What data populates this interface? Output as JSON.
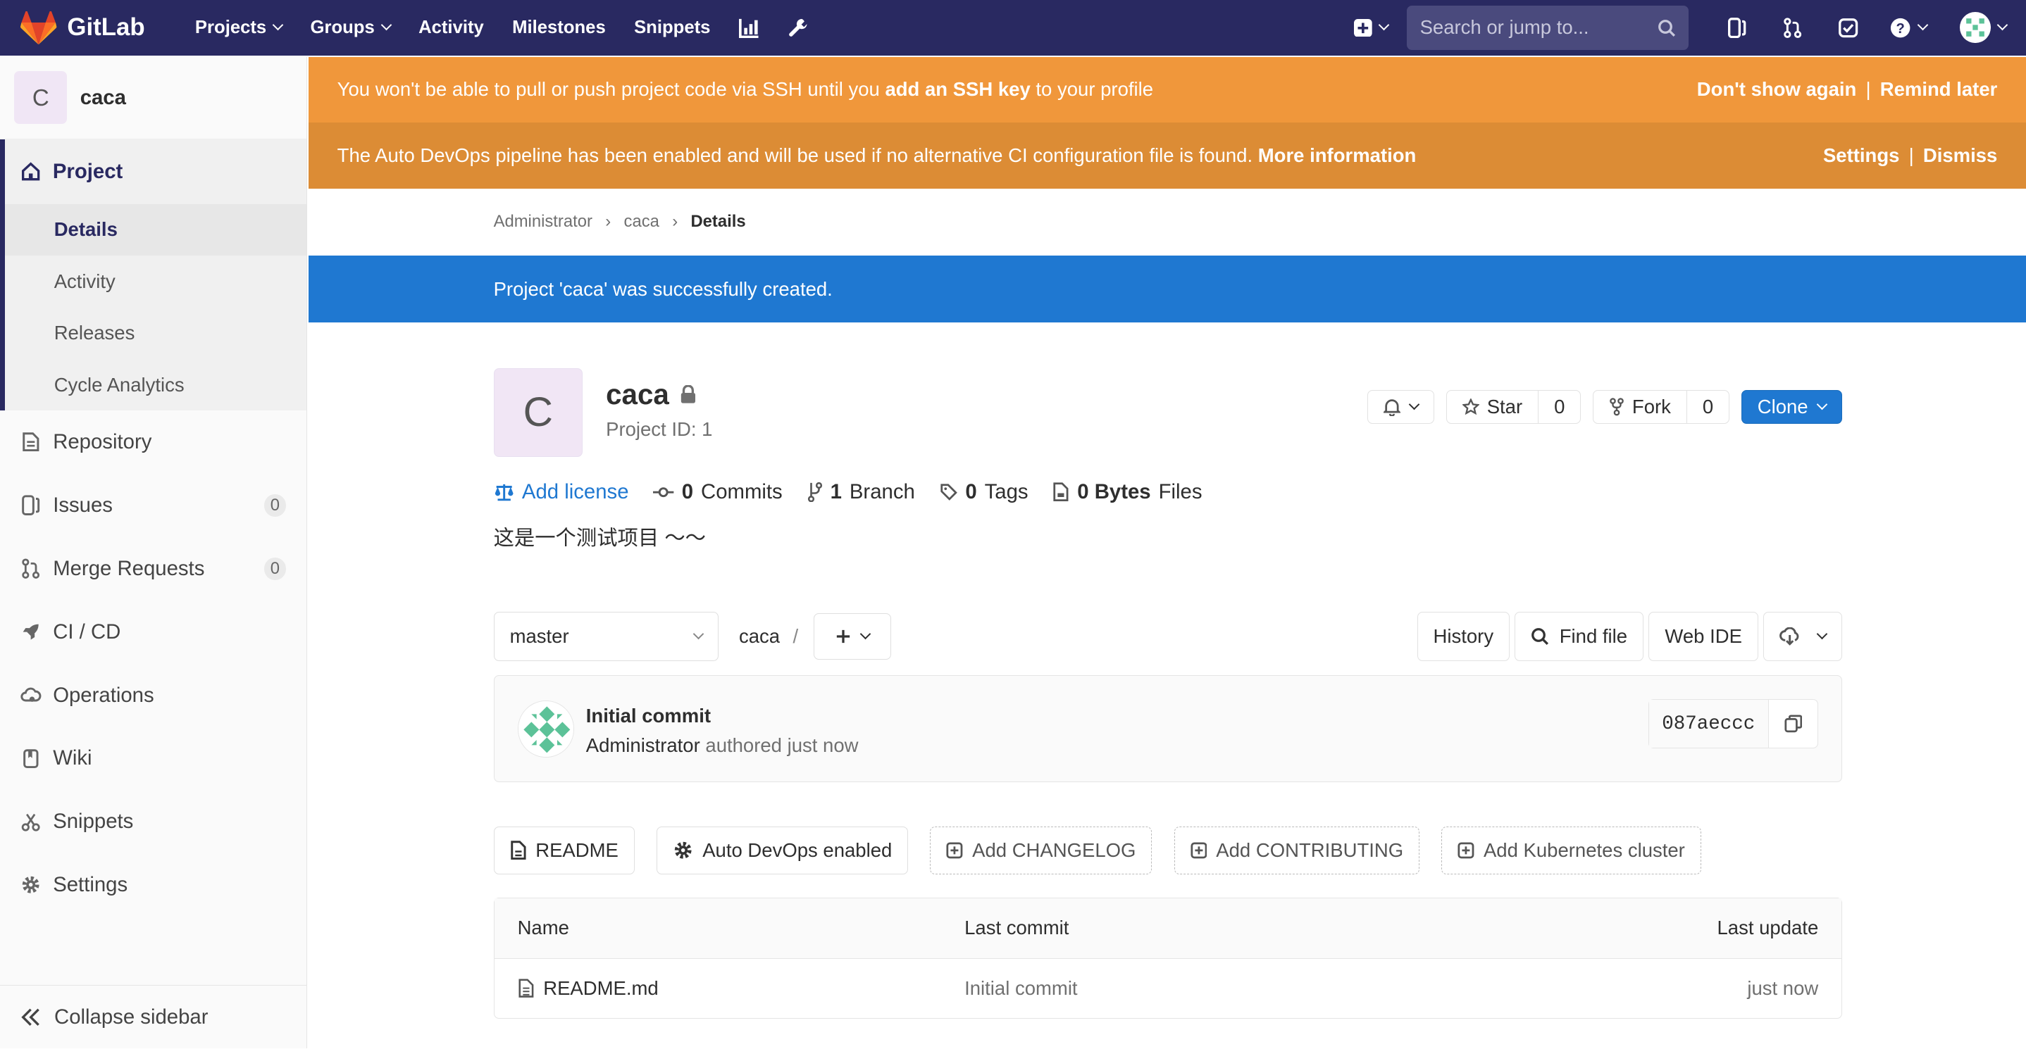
{
  "topbar": {
    "brand": "GitLab",
    "nav": [
      "Projects",
      "Groups",
      "Activity",
      "Milestones",
      "Snippets"
    ],
    "search_placeholder": "Search or jump to..."
  },
  "sidebar": {
    "project_initial": "C",
    "project_name": "caca",
    "section_title": "Project",
    "sub_items": [
      "Details",
      "Activity",
      "Releases",
      "Cycle Analytics"
    ],
    "items": [
      {
        "label": "Repository",
        "icon": "doc-icon"
      },
      {
        "label": "Issues",
        "icon": "issues-icon",
        "badge": "0"
      },
      {
        "label": "Merge Requests",
        "icon": "merge-request-icon",
        "badge": "0"
      },
      {
        "label": "CI / CD",
        "icon": "rocket-icon"
      },
      {
        "label": "Operations",
        "icon": "cloud-gear-icon"
      },
      {
        "label": "Wiki",
        "icon": "book-icon"
      },
      {
        "label": "Snippets",
        "icon": "scissors-icon"
      },
      {
        "label": "Settings",
        "icon": "gear-icon"
      }
    ],
    "collapse_label": "Collapse sidebar"
  },
  "alerts": {
    "ssh_text_1": "You won't be able to pull or push project code via SSH until you ",
    "ssh_link": "add an SSH key",
    "ssh_text_2": " to your profile",
    "ssh_dont_show": "Don't show again",
    "ssh_remind": "Remind later",
    "sep": "|",
    "devops_text": "The Auto DevOps pipeline has been enabled and will be used if no alternative CI configuration file is found. ",
    "devops_link": "More information",
    "devops_settings": "Settings",
    "devops_dismiss": "Dismiss"
  },
  "breadcrumb": [
    "Administrator",
    "caca",
    "Details"
  ],
  "flash": "Project 'caca' was successfully created.",
  "project": {
    "initial": "C",
    "name": "caca",
    "id_label": "Project ID: 1",
    "star_label": "Star",
    "star_count": "0",
    "fork_label": "Fork",
    "fork_count": "0",
    "clone_label": "Clone",
    "description": "这是一个测试项目 ～～"
  },
  "stats": {
    "add_license": "Add license",
    "commits_count": "0",
    "commits_label": "Commits",
    "branch_count": "1",
    "branch_label": "Branch",
    "tags_count": "0",
    "tags_label": "Tags",
    "files_size": "0 Bytes",
    "files_label": "Files"
  },
  "tree": {
    "branch": "master",
    "path": "caca",
    "separator": "/",
    "history": "History",
    "find_file": "Find file",
    "web_ide": "Web IDE"
  },
  "commit": {
    "title": "Initial commit",
    "author": "Administrator",
    "meta": " authored just now",
    "sha": "087aeccc"
  },
  "quick_links": {
    "readme": "README",
    "auto_devops": "Auto DevOps enabled",
    "changelog": "Add CHANGELOG",
    "contributing": "Add CONTRIBUTING",
    "kubernetes": "Add Kubernetes cluster"
  },
  "files": {
    "headers": {
      "name": "Name",
      "last_commit": "Last commit",
      "last_update": "Last update"
    },
    "rows": [
      {
        "name": "README.md",
        "last_commit": "Initial commit",
        "last_update": "just now"
      }
    ]
  },
  "colors": {
    "navbar": "#292961",
    "ssh_alert": "#f0973b",
    "devops_alert": "#dc8c35",
    "flash": "#1f78d1",
    "primary": "#1f78d1"
  }
}
